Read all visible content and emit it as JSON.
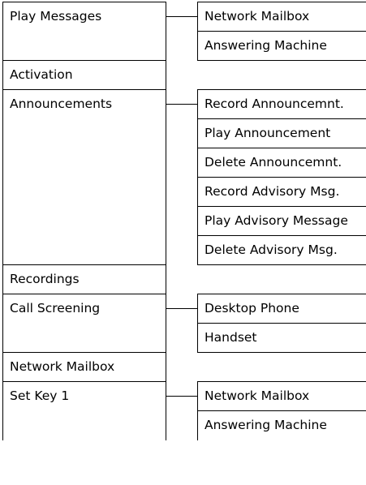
{
  "menu": [
    {
      "label": "Play Messages",
      "submenu": [
        "Network Mailbox",
        "Answering Machine"
      ]
    },
    {
      "label": "Activation",
      "submenu": []
    },
    {
      "label": "Announcements",
      "submenu": [
        "Record Announcemnt.",
        "Play Announcement",
        "Delete Announcemnt.",
        "Record Advisory Msg.",
        "Play Advisory Message",
        "Delete Advisory Msg."
      ]
    },
    {
      "label": "Recordings",
      "submenu": []
    },
    {
      "label": "Call Screening",
      "submenu": [
        "Desktop Phone",
        "Handset"
      ]
    },
    {
      "label": "Network Mailbox",
      "submenu": []
    },
    {
      "label": "Set Key 1",
      "submenu": [
        "Network Mailbox",
        "Answering Machine"
      ]
    }
  ]
}
